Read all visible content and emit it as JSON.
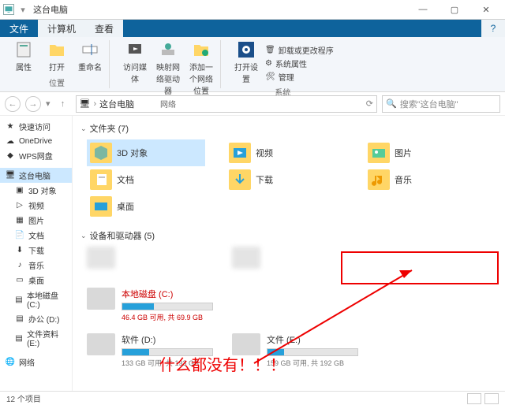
{
  "titlebar": {
    "title": "这台电脑"
  },
  "win": {
    "min": "—",
    "max": "▢",
    "close": "✕"
  },
  "tabs": {
    "file": "文件",
    "computer": "计算机",
    "view": "查看",
    "help": "?"
  },
  "ribbon": {
    "group1": {
      "label": "位置",
      "items": [
        "属性",
        "打开",
        "重命名"
      ]
    },
    "group2": {
      "label": "网络",
      "items": [
        "访问媒体",
        "映射网络驱动器",
        "添加一个网络位置"
      ]
    },
    "group3": {
      "label": "系统",
      "open": "打开设置",
      "opts": [
        "卸载或更改程序",
        "系统属性",
        "管理"
      ]
    }
  },
  "addr": {
    "root": "这台电脑",
    "search_ph": "搜索\"这台电脑\""
  },
  "sidebar": {
    "items": [
      {
        "label": "快速访问",
        "icon": "star"
      },
      {
        "label": "OneDrive",
        "icon": "cloud"
      },
      {
        "label": "WPS网盘",
        "icon": "wps"
      },
      {
        "label": "这台电脑",
        "icon": "pc",
        "sel": true
      },
      {
        "label": "3D 对象",
        "icon": "cube",
        "sub": true
      },
      {
        "label": "视频",
        "icon": "video",
        "sub": true
      },
      {
        "label": "图片",
        "icon": "pic",
        "sub": true
      },
      {
        "label": "文档",
        "icon": "doc",
        "sub": true
      },
      {
        "label": "下载",
        "icon": "dl",
        "sub": true
      },
      {
        "label": "音乐",
        "icon": "music",
        "sub": true
      },
      {
        "label": "桌面",
        "icon": "desk",
        "sub": true
      },
      {
        "label": "本地磁盘 (C:)",
        "icon": "drive",
        "sub": true
      },
      {
        "label": "办公 (D:)",
        "icon": "drive",
        "sub": true
      },
      {
        "label": "文件资料 (E:)",
        "icon": "drive",
        "sub": true
      },
      {
        "label": "网络",
        "icon": "net"
      }
    ]
  },
  "main": {
    "folders_hdr": "文件夹 (7)",
    "folders": [
      {
        "label": "3D 对象",
        "sel": true,
        "icon": "cube"
      },
      {
        "label": "视频",
        "icon": "video"
      },
      {
        "label": "图片",
        "icon": "pic"
      },
      {
        "label": "文档",
        "icon": "doc"
      },
      {
        "label": "下载",
        "icon": "dl"
      },
      {
        "label": "音乐",
        "icon": "music"
      },
      {
        "label": "桌面",
        "icon": "desk"
      }
    ],
    "drives_hdr": "设备和驱动器 (5)",
    "drives": [
      {
        "name": "",
        "sub": "",
        "blur": true
      },
      {
        "name": "",
        "sub": "",
        "blur": true
      },
      {
        "name": "本地磁盘 (C:)",
        "sub": "46.4 GB 可用, 共 69.9 GB",
        "red": true,
        "fill": 35
      },
      {
        "name": "软件 (D:)",
        "sub": "133 GB 可用, 共 193 GB",
        "fill": 30
      },
      {
        "name": "文件 (E:)",
        "sub": "159 GB 可用, 共 192 GB",
        "fill": 18
      }
    ]
  },
  "annotation": "什么都没有！！！",
  "status": {
    "count": "12 个项目"
  }
}
